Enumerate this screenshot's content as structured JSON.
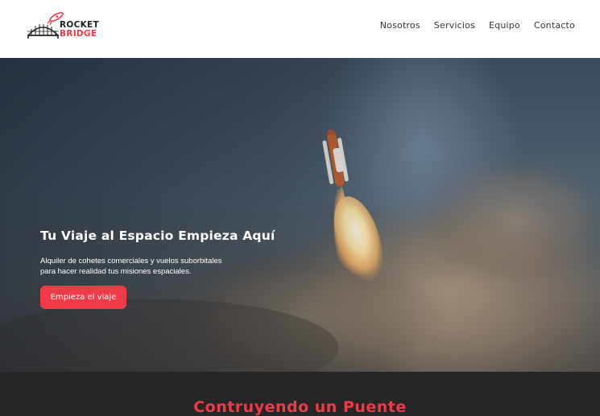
{
  "brand": {
    "logo_line1": "ROCKET",
    "logo_line2": "BRIDGE",
    "logo_icons": [
      "rocket-icon",
      "bridge-icon"
    ],
    "colors": {
      "accent": "#f03a47",
      "dark": "#222222"
    }
  },
  "nav": {
    "items": [
      {
        "label": "Nosotros"
      },
      {
        "label": "Servicios"
      },
      {
        "label": "Equipo"
      },
      {
        "label": "Contacto"
      }
    ]
  },
  "hero": {
    "title": "Tu Viaje al Espacio Empieza Aquí",
    "subtitle_line1": "Alquiler de cohetes comerciales y vuelos suborbitales",
    "subtitle_line2": "para hacer realidad tus misiones espaciales.",
    "cta_label": "Empieza el viaje",
    "background": "rocket-launch-image"
  },
  "section": {
    "title": "Contruyendo un Puente",
    "background": "#262626"
  }
}
